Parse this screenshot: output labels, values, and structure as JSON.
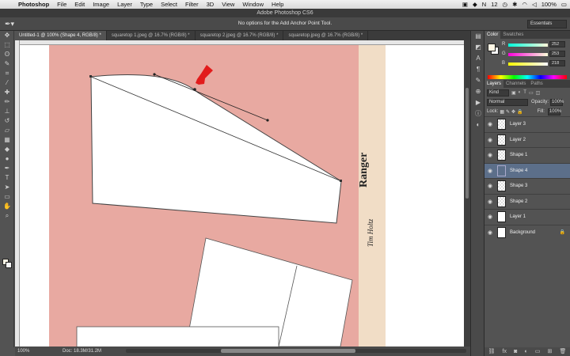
{
  "menubar": {
    "apple_icon": "",
    "items": [
      "Photoshop",
      "File",
      "Edit",
      "Image",
      "Layer",
      "Type",
      "Select",
      "Filter",
      "3D",
      "View",
      "Window",
      "Help"
    ],
    "status_icons": [
      "adobe-icon",
      "dropbox-icon",
      "notification-icon",
      "clock-icon",
      "bluetooth-icon",
      "wifi-icon",
      "sound-icon"
    ],
    "battery": "100%",
    "time": "12"
  },
  "window": {
    "title": "Adobe Photoshop CS6"
  },
  "options_bar": {
    "message": "No options for the Add Anchor Point Tool.",
    "workspace": "Essentials"
  },
  "tabs": [
    {
      "label": "Untitled-1 @ 100% (Shape 4, RGB/8) *",
      "active": true
    },
    {
      "label": "squaretop 1.jpeg @ 16.7% (RGB/8) *",
      "active": false
    },
    {
      "label": "squaretop 2.jpeg @ 16.7% (RGB/8) *",
      "active": false
    },
    {
      "label": "squaretop.jpeg @ 16.7% (RGB/8) *",
      "active": false
    }
  ],
  "canvas": {
    "background_color": "#e8a9a1",
    "stamp_text": "Ranger",
    "signature_text": "Tim Holtz"
  },
  "statusbar": {
    "zoom": "100%",
    "doc": "Doc: 18.3M/31.2M"
  },
  "color_panel": {
    "tabs": [
      "Color",
      "Swatches"
    ],
    "sliders": [
      {
        "label": "R",
        "value": "252"
      },
      {
        "label": "G",
        "value": "253"
      },
      {
        "label": "B",
        "value": "218"
      }
    ]
  },
  "layers_panel": {
    "tabs": [
      "Layers",
      "Channels",
      "Paths"
    ],
    "kind": "Kind",
    "blend_mode": "Normal",
    "opacity_label": "Opacity:",
    "opacity": "100%",
    "lock_label": "Lock:",
    "fill_label": "Fill:",
    "fill": "100%",
    "layers": [
      {
        "name": "Layer 3",
        "thumb": "checker",
        "selected": false
      },
      {
        "name": "Layer 2",
        "thumb": "checker",
        "selected": false
      },
      {
        "name": "Shape 1",
        "thumb": "checker",
        "selected": false
      },
      {
        "name": "Shape 4",
        "thumb": "shape",
        "selected": true
      },
      {
        "name": "Shape 3",
        "thumb": "checker",
        "selected": false
      },
      {
        "name": "Shape 2",
        "thumb": "checker",
        "selected": false
      },
      {
        "name": "Layer 1",
        "thumb": "white",
        "selected": false
      },
      {
        "name": "Background",
        "thumb": "white",
        "selected": false
      }
    ]
  }
}
